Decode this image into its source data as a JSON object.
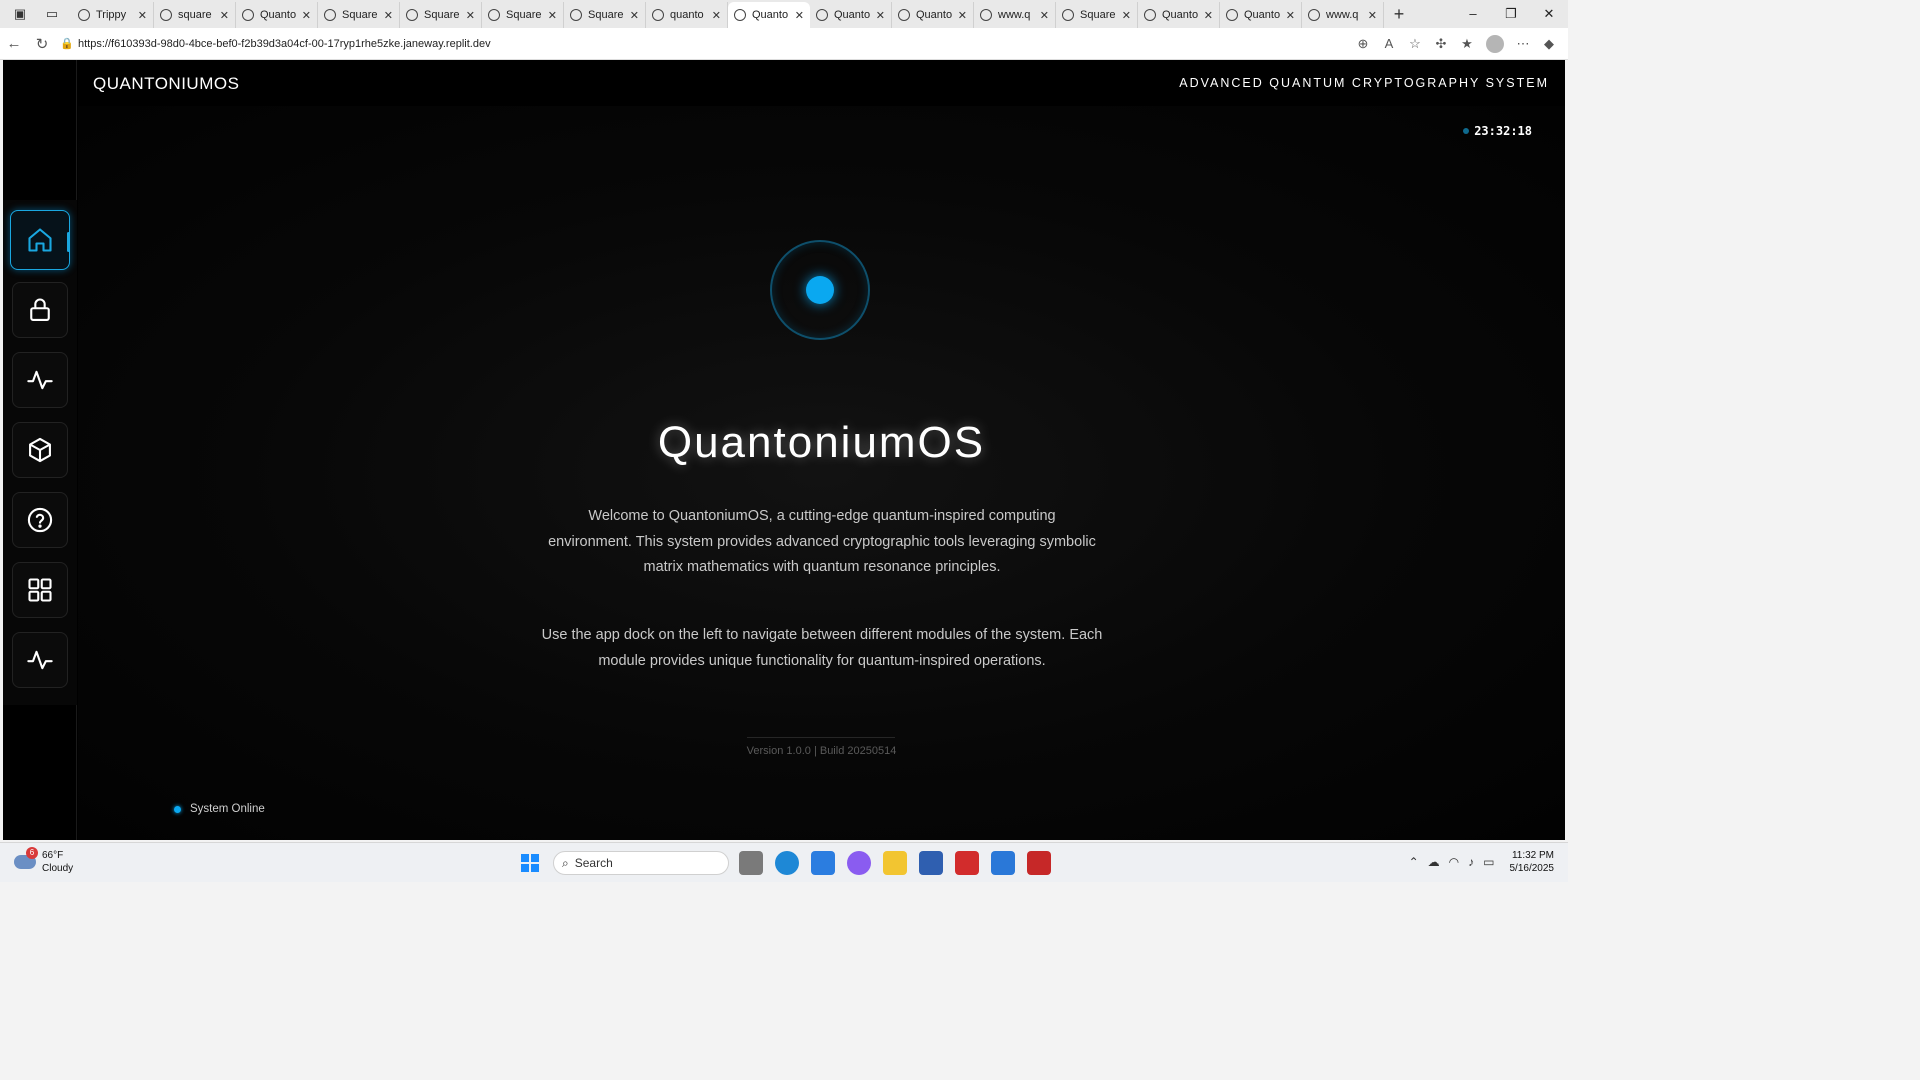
{
  "browser": {
    "tabs": [
      {
        "title": "Trippy",
        "active": false
      },
      {
        "title": "square",
        "active": false
      },
      {
        "title": "Quanto",
        "active": false
      },
      {
        "title": "Square",
        "active": false
      },
      {
        "title": "Square",
        "active": false
      },
      {
        "title": "Square",
        "active": false
      },
      {
        "title": "Square",
        "active": false
      },
      {
        "title": "quanto",
        "active": false
      },
      {
        "title": "Quanto",
        "active": true
      },
      {
        "title": "Quanto",
        "active": false
      },
      {
        "title": "Quanto",
        "active": false
      },
      {
        "title": "www.q",
        "active": false
      },
      {
        "title": "Square",
        "active": false
      },
      {
        "title": "Quanto",
        "active": false
      },
      {
        "title": "Quanto",
        "active": false
      },
      {
        "title": "www.q",
        "active": false
      }
    ],
    "url": "https://f610393d-98d0-4bce-bef0-f2b39d3a04cf-00-17ryp1rhe5zke.janeway.replit.dev"
  },
  "app": {
    "brand": "QUANTONIUMOS",
    "subtitle": "ADVANCED QUANTUM CRYPTOGRAPHY SYSTEM",
    "clock": "23:32:18",
    "dock": [
      {
        "name": "home",
        "icon": "home-icon",
        "active": true
      },
      {
        "name": "encryption",
        "icon": "lock-icon",
        "active": false
      },
      {
        "name": "analyzer",
        "icon": "activity-icon",
        "active": false
      },
      {
        "name": "container",
        "icon": "cube-icon",
        "active": false
      },
      {
        "name": "help",
        "icon": "help-circle-icon",
        "active": false
      },
      {
        "name": "apps",
        "icon": "grid-icon",
        "active": false
      },
      {
        "name": "monitor",
        "icon": "activity-icon",
        "active": false
      }
    ],
    "hero": {
      "title": "QuantoniumOS",
      "paragraph1": "Welcome to QuantoniumOS, a cutting-edge quantum-inspired computing environment. This system provides advanced cryptographic tools leveraging symbolic matrix mathematics with quantum resonance principles.",
      "paragraph2": "Use the app dock on the left to navigate between different modules of the system. Each module provides unique functionality for quantum-inspired operations."
    },
    "version": "Version 1.0.0 | Build 20250514",
    "status": "System Online",
    "accent_color": "#0aa8f0"
  },
  "taskbar": {
    "weather_temp": "66°F",
    "weather_desc": "Cloudy",
    "weather_badge": "6",
    "search_placeholder": "Search",
    "time": "11:32 PM",
    "date": "5/16/2025"
  }
}
